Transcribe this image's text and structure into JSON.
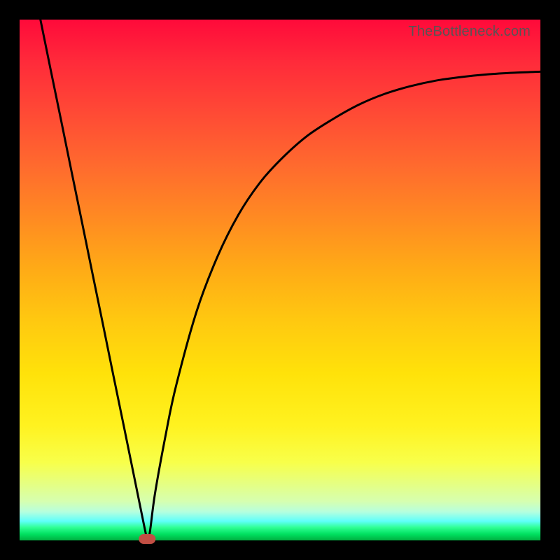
{
  "watermark": "TheBottleneck.com",
  "chart_data": {
    "type": "line",
    "title": "",
    "xlabel": "",
    "ylabel": "",
    "xlim": [
      0,
      1
    ],
    "ylim": [
      0,
      1
    ],
    "background_gradient": "red-yellow-green vertical",
    "series": [
      {
        "name": "bottleneck-curve",
        "x": [
          0.04,
          0.06,
          0.08,
          0.1,
          0.12,
          0.14,
          0.16,
          0.18,
          0.2,
          0.22,
          0.24,
          0.245,
          0.25,
          0.26,
          0.28,
          0.3,
          0.34,
          0.38,
          0.42,
          0.46,
          0.5,
          0.55,
          0.6,
          0.65,
          0.7,
          0.75,
          0.8,
          0.85,
          0.9,
          0.95,
          1.0
        ],
        "y": [
          1.0,
          0.902,
          0.805,
          0.707,
          0.61,
          0.512,
          0.415,
          0.317,
          0.22,
          0.122,
          0.024,
          0.0,
          0.015,
          0.09,
          0.2,
          0.295,
          0.44,
          0.545,
          0.625,
          0.685,
          0.73,
          0.775,
          0.808,
          0.836,
          0.857,
          0.872,
          0.883,
          0.89,
          0.895,
          0.898,
          0.9
        ]
      }
    ],
    "marker": {
      "x": 0.245,
      "y": 0.0,
      "color": "#c24f44",
      "shape": "capsule"
    }
  }
}
